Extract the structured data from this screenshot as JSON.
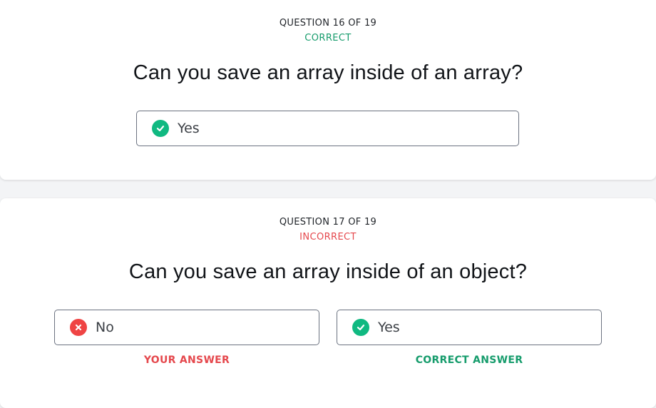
{
  "questions": [
    {
      "number_label": "QUESTION 16 OF 19",
      "status": "CORRECT",
      "text": "Can you save an array inside of an array?",
      "answers": [
        {
          "label": "Yes",
          "icon": "check-circle-icon"
        }
      ]
    },
    {
      "number_label": "QUESTION 17 OF 19",
      "status": "INCORRECT",
      "text": "Can you save an array inside of an object?",
      "answers": [
        {
          "label": "No",
          "icon": "x-circle-icon",
          "note": "YOUR ANSWER"
        },
        {
          "label": "Yes",
          "icon": "check-circle-icon",
          "note": "CORRECT ANSWER"
        }
      ]
    }
  ],
  "colors": {
    "correct": "#169c6c",
    "incorrect": "#e5484d",
    "check_icon_bg": "#10b981",
    "x_icon_bg": "#ef4444",
    "border": "#6b7280",
    "page_bg": "#f3f4f6"
  }
}
